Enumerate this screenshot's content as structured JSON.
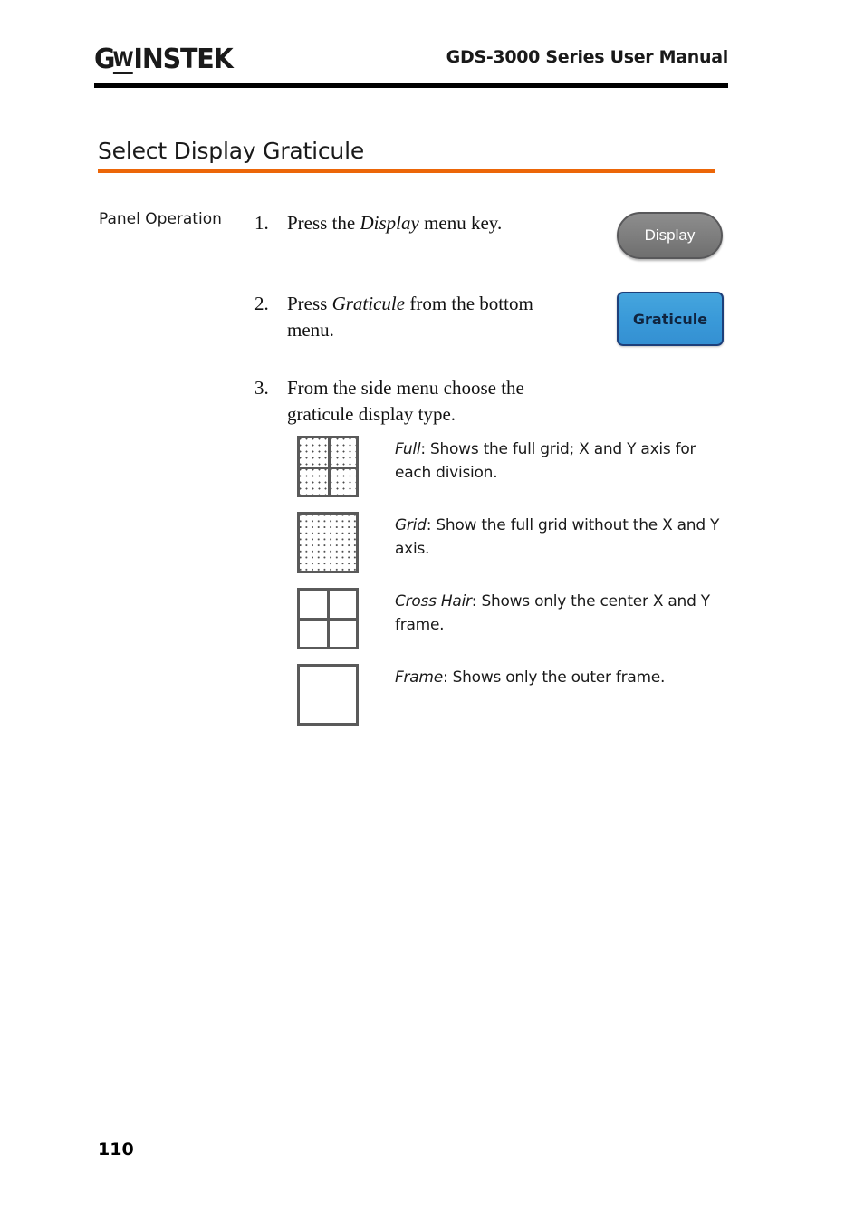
{
  "header": {
    "logo_text": "GW INSTEK",
    "logo_g": "G",
    "logo_w": "W",
    "logo_rest": "INSTEK",
    "manual_title": "GDS-3000 Series User Manual"
  },
  "section": {
    "title": "Select Display Graticule",
    "accent_color": "#ec6608"
  },
  "body": {
    "panel_operation_label": "Panel Operation",
    "steps": [
      {
        "number": "1.",
        "text_before": "Press the ",
        "emphasis": "Display",
        "text_after": " menu key."
      },
      {
        "number": "2.",
        "text_before": "Press ",
        "emphasis": "Graticule",
        "text_after": " from the bottom menu."
      },
      {
        "number": "3.",
        "text_before": "From the side menu choose the graticule display type.",
        "emphasis": "",
        "text_after": ""
      }
    ]
  },
  "panel_buttons": {
    "display": {
      "label": "Display",
      "fill_color": "#808080",
      "text_color": "#ffffff",
      "border_color": "#58585a"
    },
    "graticule": {
      "label": "Graticule",
      "fill_color": "#3a9ad9",
      "text_color": "#10243f",
      "border_color": "#1d3f7a"
    }
  },
  "graticule_options": [
    {
      "icon": "graticule-full-icon",
      "name": "Full",
      "separator": ": ",
      "description": "Shows the full grid; X and Y axis for each division."
    },
    {
      "icon": "graticule-grid-icon",
      "name": "Grid",
      "separator": ": ",
      "description": "Show the full grid without the X and Y axis."
    },
    {
      "icon": "graticule-cross-hair-icon",
      "name": "Cross Hair",
      "separator": ": ",
      "description": "Shows only the center X and Y frame."
    },
    {
      "icon": "graticule-frame-icon",
      "name": "Frame",
      "separator": ": ",
      "description": "Shows only the outer frame."
    }
  ],
  "footer": {
    "page_number": "110"
  }
}
